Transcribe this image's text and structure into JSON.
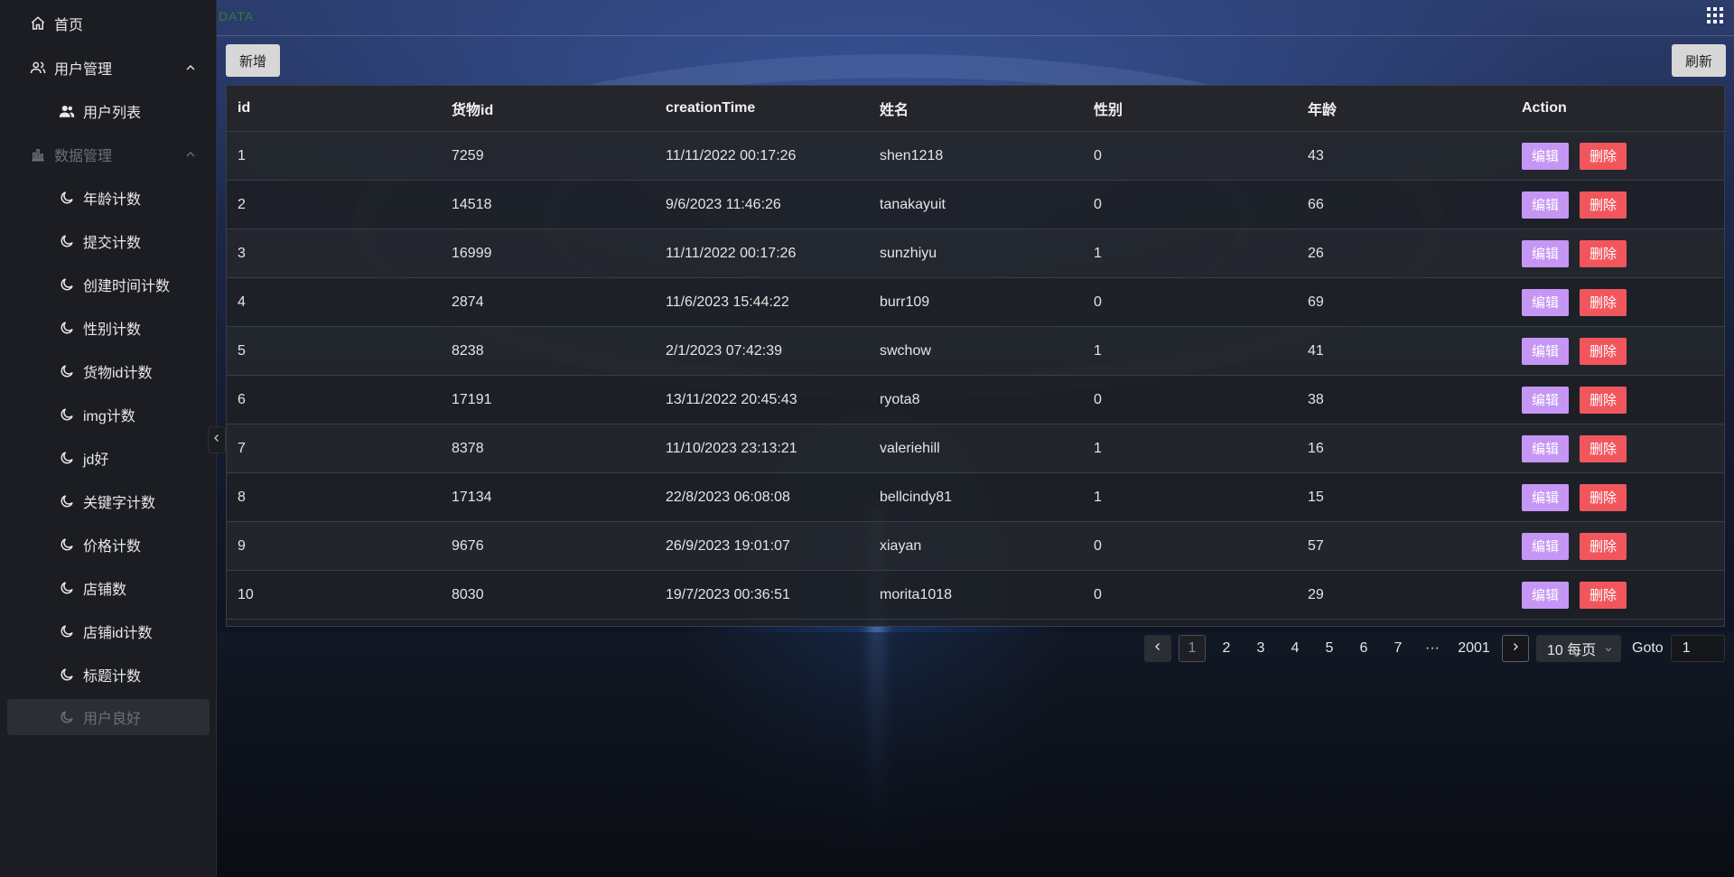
{
  "brand": "DATA",
  "sidebar": {
    "items": [
      {
        "label": "首页",
        "icon": "home-icon"
      },
      {
        "label": "用户管理",
        "icon": "users-icon"
      },
      {
        "label": "用户列表",
        "icon": "user-group-icon"
      },
      {
        "label": "数据管理",
        "icon": "bar-chart-icon"
      },
      {
        "label": "年龄计数",
        "icon": "moon-icon"
      },
      {
        "label": "提交计数",
        "icon": "moon-icon"
      },
      {
        "label": "创建时间计数",
        "icon": "moon-icon"
      },
      {
        "label": "性别计数",
        "icon": "moon-icon"
      },
      {
        "label": "货物id计数",
        "icon": "moon-icon"
      },
      {
        "label": "img计数",
        "icon": "moon-icon"
      },
      {
        "label": "jd好",
        "icon": "moon-icon"
      },
      {
        "label": "关键字计数",
        "icon": "moon-icon"
      },
      {
        "label": "价格计数",
        "icon": "moon-icon"
      },
      {
        "label": "店铺数",
        "icon": "moon-icon"
      },
      {
        "label": "店铺id计数",
        "icon": "moon-icon"
      },
      {
        "label": "标题计数",
        "icon": "moon-icon"
      },
      {
        "label": "用户良好",
        "icon": "moon-icon"
      }
    ]
  },
  "toolbar": {
    "add_label": "新增",
    "refresh_label": "刷新"
  },
  "table": {
    "columns": [
      "id",
      "货物id",
      "creationTime",
      "姓名",
      "性别",
      "年龄",
      "Action"
    ],
    "rows": [
      [
        "1",
        "7259",
        "11/11/2022 00:17:26",
        "shen1218",
        "0",
        "43"
      ],
      [
        "2",
        "14518",
        "9/6/2023 11:46:26",
        "tanakayuit",
        "0",
        "66"
      ],
      [
        "3",
        "16999",
        "11/11/2022 00:17:26",
        "sunzhiyu",
        "1",
        "26"
      ],
      [
        "4",
        "2874",
        "11/6/2023 15:44:22",
        "burr109",
        "0",
        "69"
      ],
      [
        "5",
        "8238",
        "2/1/2023 07:42:39",
        "swchow",
        "1",
        "41"
      ],
      [
        "6",
        "17191",
        "13/11/2022 20:45:43",
        "ryota8",
        "0",
        "38"
      ],
      [
        "7",
        "8378",
        "11/10/2023 23:13:21",
        "valeriehill",
        "1",
        "16"
      ],
      [
        "8",
        "17134",
        "22/8/2023 06:08:08",
        "bellcindy81",
        "1",
        "15"
      ],
      [
        "9",
        "9676",
        "26/9/2023 19:01:07",
        "xiayan",
        "0",
        "57"
      ],
      [
        "10",
        "8030",
        "19/7/2023 00:36:51",
        "morita1018",
        "0",
        "29"
      ]
    ],
    "edit_label": "编辑",
    "delete_label": "删除"
  },
  "pagination": {
    "pages": [
      "1",
      "2",
      "3",
      "4",
      "5",
      "6",
      "7",
      "···",
      "2001"
    ],
    "current": "1",
    "page_size": "10 每页",
    "goto_label": "Goto",
    "goto_value": "1"
  },
  "colors": {
    "edit_button": "#c596f4",
    "delete_button": "#f2565d",
    "sidebar_bg": "#1b1d22"
  }
}
